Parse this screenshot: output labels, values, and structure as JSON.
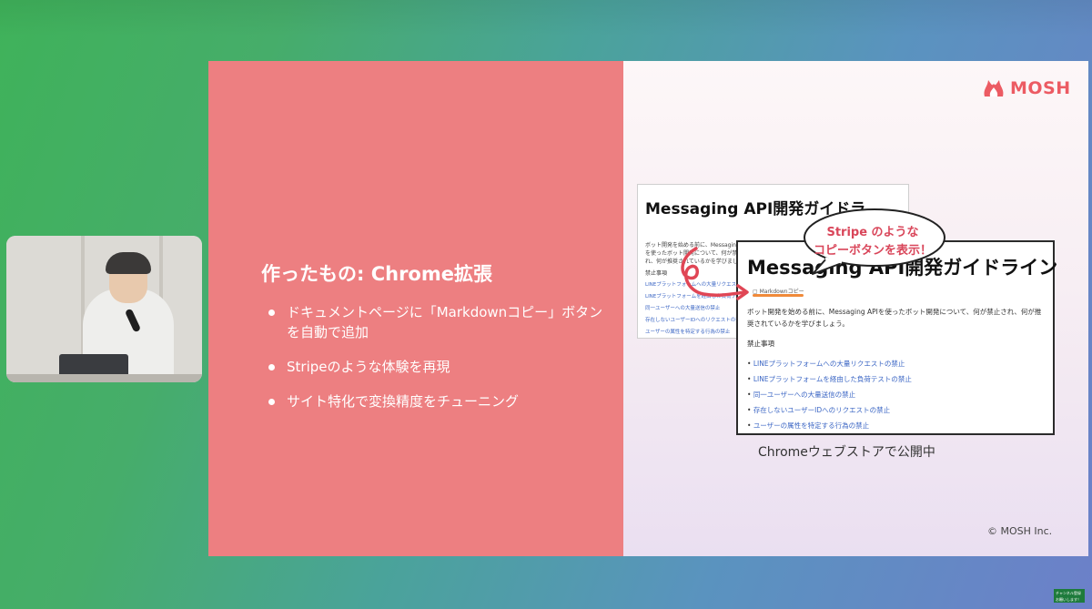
{
  "slide": {
    "title": "作ったもの: Chrome拡張",
    "bullets": [
      "ドキュメントページに「Markdownコピー」ボタンを自動で追加",
      "Stripeのような体験を再現",
      "サイト特化で変換精度をチューニング"
    ],
    "logo_text": "MOSH",
    "callout_line1": "Stripe のような",
    "callout_line2": "コピーボタンを表示！",
    "caption": "Chromeウェブストアで公開中",
    "copyright": "© MOSH Inc."
  },
  "doc_back": {
    "heading": "Messaging API開発ガイドラ",
    "intro": "ボット開発を始める前に、Messaging APIを使ったボット開発について、何が禁止され、何が推奨されているかを学びましょう。",
    "section": "禁止事項",
    "links": [
      "LINEプラットフォームへの大量リクエストの禁止",
      "LINEプラットフォームを経由した負荷テストの禁止",
      "同一ユーザーへの大量送信の禁止",
      "存在しないユーザーIDへのリクエストの禁止",
      "ユーザーの属性を特定する行為の禁止"
    ]
  },
  "doc_front": {
    "heading": "Messaging API開発ガイドライン",
    "copy_button": "Markdownコピー",
    "intro": "ボット開発を始める前に、Messaging APIを使ったボット開発について、何が禁止され、何が推奨されているかを学びましょう。",
    "section": "禁止事項",
    "links": [
      "LINEプラットフォームへの大量リクエストの禁止",
      "LINEプラットフォームを経由した負荷テストの禁止",
      "同一ユーザーへの大量送信の禁止",
      "存在しないユーザーIDへのリクエストの禁止",
      "ユーザーの属性を特定する行為の禁止"
    ]
  },
  "subscribe": {
    "line1": "チャンネル登録",
    "line2": "お願いします！"
  },
  "colors": {
    "slide_left": "#ed7f81",
    "accent": "#ec5b63",
    "callout_text": "#d9465a",
    "link": "#3b66c4",
    "underline": "#f08a3a"
  }
}
